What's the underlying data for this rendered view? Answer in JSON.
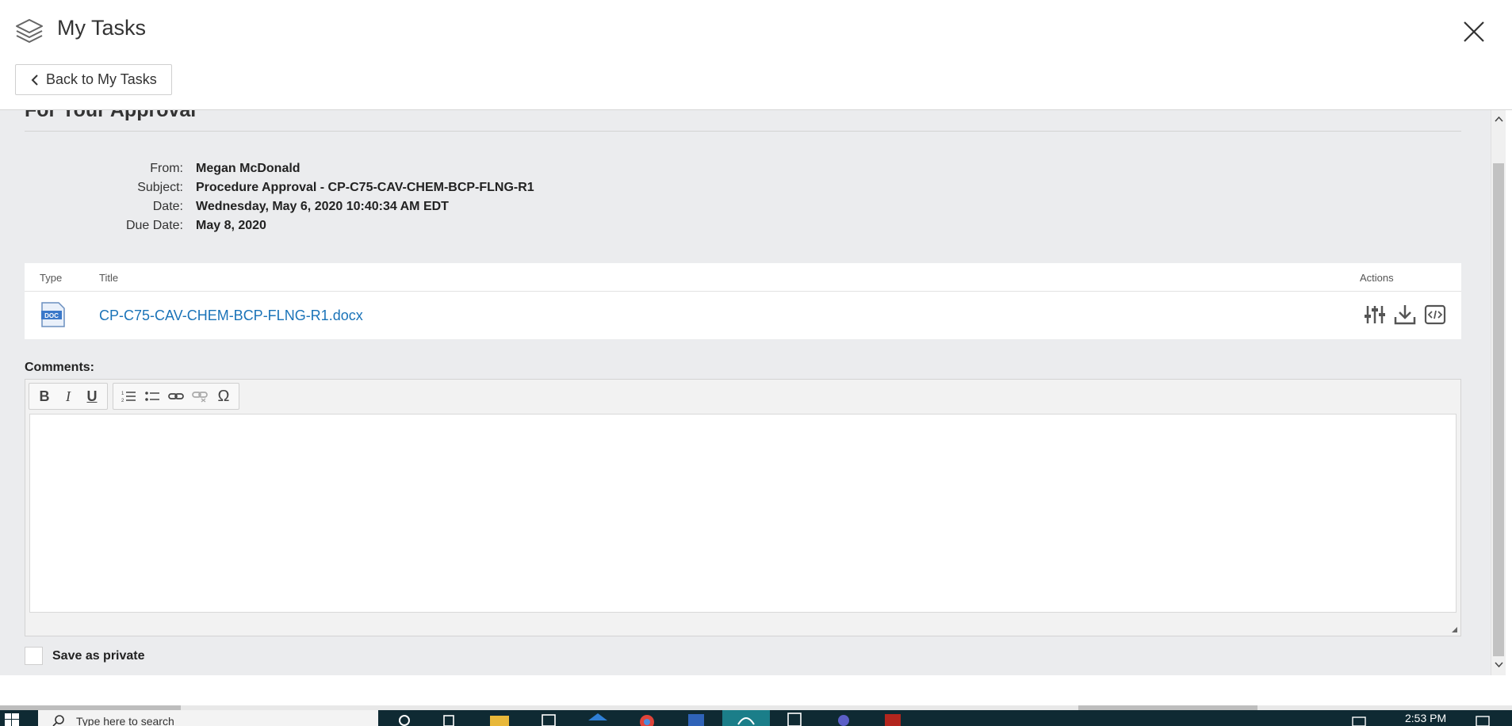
{
  "header": {
    "title": "My Tasks",
    "back_label": "Back to My Tasks"
  },
  "section": {
    "title": "For Your Approval"
  },
  "meta": {
    "from_label": "From:",
    "from_value": "Megan McDonald",
    "subject_label": "Subject:",
    "subject_value": "Procedure Approval - CP-C75-CAV-CHEM-BCP-FLNG-R1",
    "date_label": "Date:",
    "date_value": "Wednesday, May 6, 2020 10:40:34 AM EDT",
    "due_label": "Due Date:",
    "due_value": "May 8, 2020"
  },
  "documents": {
    "columns": {
      "type": "Type",
      "title": "Title",
      "actions": "Actions"
    },
    "rows": [
      {
        "type_badge": "DOC",
        "title": "CP-C75-CAV-CHEM-BCP-FLNG-R1.docx"
      }
    ]
  },
  "comments": {
    "label": "Comments:",
    "toolbar": [
      "bold",
      "italic",
      "underline",
      "numbered-list",
      "bulleted-list",
      "link",
      "unlink",
      "special-character"
    ],
    "value": ""
  },
  "private": {
    "label": "Save as private",
    "checked": false
  },
  "taskbar": {
    "search_placeholder": "Type here to search",
    "time": "2:53 PM"
  },
  "colors": {
    "link": "#1a73b8",
    "panel_bg": "#ebecee",
    "taskbar_bg": "#0f2a33",
    "taskbar_active": "#1b7e89"
  }
}
